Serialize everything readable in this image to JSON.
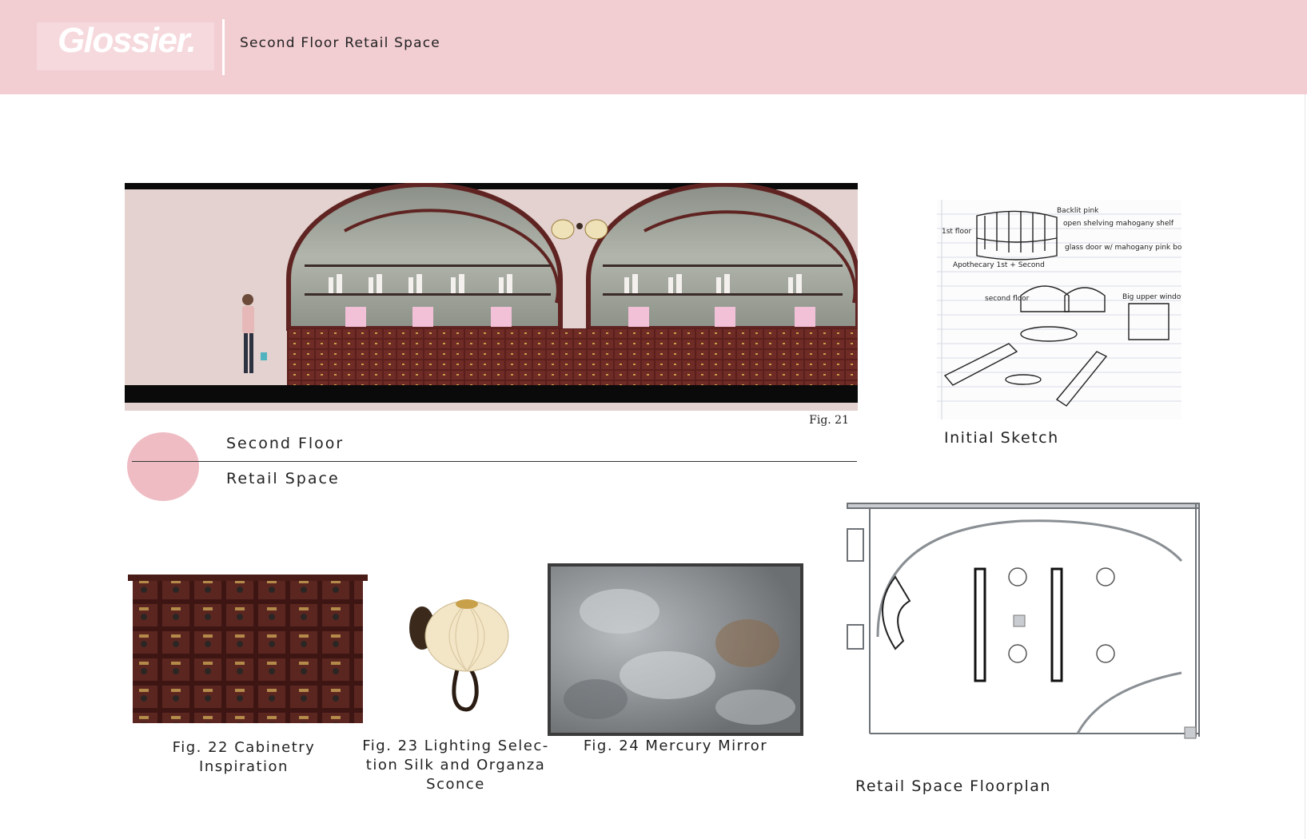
{
  "header": {
    "logo": "Glossier.",
    "title": "Second Floor Retail Space"
  },
  "elevation": {
    "fig_label": "Fig. 21"
  },
  "section": {
    "line1": "Second Floor",
    "line2": "Retail Space"
  },
  "sketch": {
    "caption": "Initial Sketch",
    "notes": [
      "1st floor",
      "Apothecary 1st + Second",
      "Backlit pink",
      "open shelving mahogany shelf",
      "glass door w/ mahogany pink boxes",
      "second floor",
      "Big upper window"
    ]
  },
  "figures": {
    "cabinetry": {
      "line1": "Fig. 22 Cabinetry",
      "line2": "Inspiration"
    },
    "lighting": {
      "line1": "Fig. 23 Lighting Selec-",
      "line2": "tion Silk and Organza",
      "line3": "Sconce"
    },
    "mirror": {
      "caption": "Fig. 24 Mercury Mirror"
    },
    "floorplan": {
      "caption": "Retail Space Floorplan"
    }
  },
  "colors": {
    "header_pink": "#f2cdd2",
    "accent_pink": "#efbcc3",
    "mahogany": "#5a1f1c"
  }
}
